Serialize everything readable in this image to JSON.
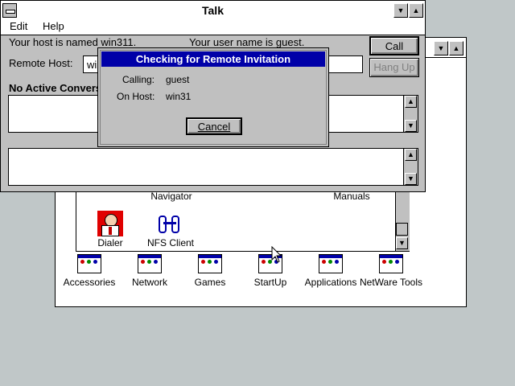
{
  "talk": {
    "title": "Talk",
    "menu": [
      "Edit",
      "Help"
    ],
    "host_text": "Your host is named win311.",
    "user_text": "Your user name is guest.",
    "remote_host_label": "Remote Host:",
    "remote_host_value": "wi",
    "call_button": "Call",
    "hangup_button": "Hang Up",
    "status": "No Active Conversa"
  },
  "dialog": {
    "title": "Checking for Remote Invitation",
    "calling_label": "Calling:",
    "calling_value": "guest",
    "host_label": "On Host:",
    "host_value": "win31",
    "cancel_button": "Cancel"
  },
  "program_manager": {
    "window_icons": [
      {
        "label": "Navigator"
      },
      {
        "label": "Manuals"
      },
      {
        "label": "Dialer"
      },
      {
        "label": "NFS Client"
      }
    ],
    "groups": [
      {
        "label": "Accessories"
      },
      {
        "label": "Network"
      },
      {
        "label": "Games"
      },
      {
        "label": "StartUp"
      },
      {
        "label": "Applications"
      },
      {
        "label": "NetWare Tools"
      }
    ]
  },
  "colors": {
    "active_title": "#0000a8",
    "face": "#c0c0c0",
    "desktop": "#c0c7c8"
  }
}
